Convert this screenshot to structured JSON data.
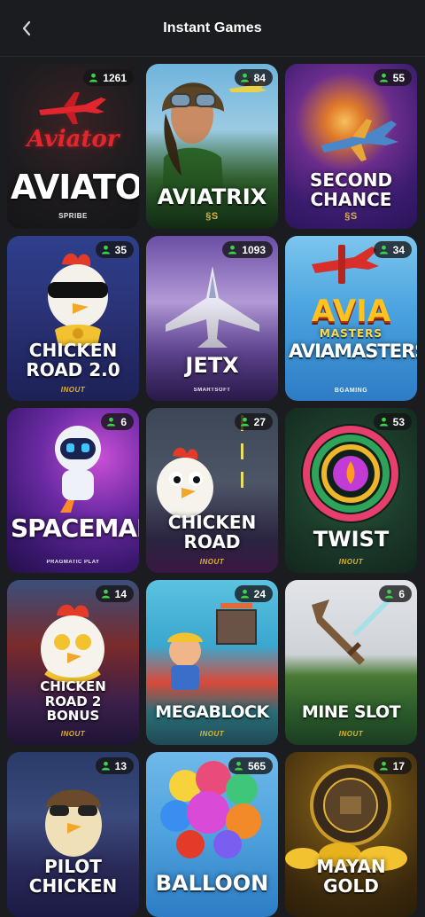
{
  "header": {
    "title": "Instant Games",
    "back_icon": "chevron-left-icon"
  },
  "user_icon": "user-icon",
  "accent_online": "#3ed24a",
  "games": [
    {
      "id": "aviator",
      "name": "AVIATOR",
      "players": "1261",
      "provider": "SPRIBE",
      "logo_text": "Aviator"
    },
    {
      "id": "aviatrix",
      "name": "AVIATRIX",
      "players": "84",
      "provider": "§S"
    },
    {
      "id": "second-chance",
      "name": "SECOND\nCHANCE",
      "players": "55",
      "provider": "§S"
    },
    {
      "id": "chicken-road-2",
      "name": "CHICKEN\nROAD 2.0",
      "players": "35",
      "provider": "INOUT"
    },
    {
      "id": "jetx",
      "name": "JETX",
      "players": "1093",
      "provider": "SMARTSOFT"
    },
    {
      "id": "aviamasters",
      "name": "AVIAMASTERS",
      "players": "34",
      "provider": "BGAMING",
      "logo_text": "AVIA",
      "logo_sub": "MASTERS"
    },
    {
      "id": "spaceman",
      "name": "SPACEMAN",
      "players": "6",
      "provider": "PRAGMATIC PLAY"
    },
    {
      "id": "chicken-road",
      "name": "CHICKEN\nROAD",
      "players": "27",
      "provider": "INOUT"
    },
    {
      "id": "twist",
      "name": "TWIST",
      "players": "53",
      "provider": "INOUT"
    },
    {
      "id": "chicken-road-2-bonus",
      "name": "CHICKEN\nROAD 2\nBONUS",
      "players": "14",
      "provider": "INOUT"
    },
    {
      "id": "megablock",
      "name": "MEGABLOCK",
      "players": "24",
      "provider": "INOUT"
    },
    {
      "id": "mine-slot",
      "name": "MINE SLOT",
      "players": "6",
      "provider": "INOUT"
    },
    {
      "id": "pilot-chicken",
      "name": "PILOT\nCHICKEN",
      "players": "13",
      "provider": ""
    },
    {
      "id": "balloon",
      "name": "BALLOON",
      "players": "565",
      "provider": ""
    },
    {
      "id": "mayan-gold",
      "name": "MAYAN\nGOLD",
      "players": "17",
      "provider": ""
    }
  ]
}
